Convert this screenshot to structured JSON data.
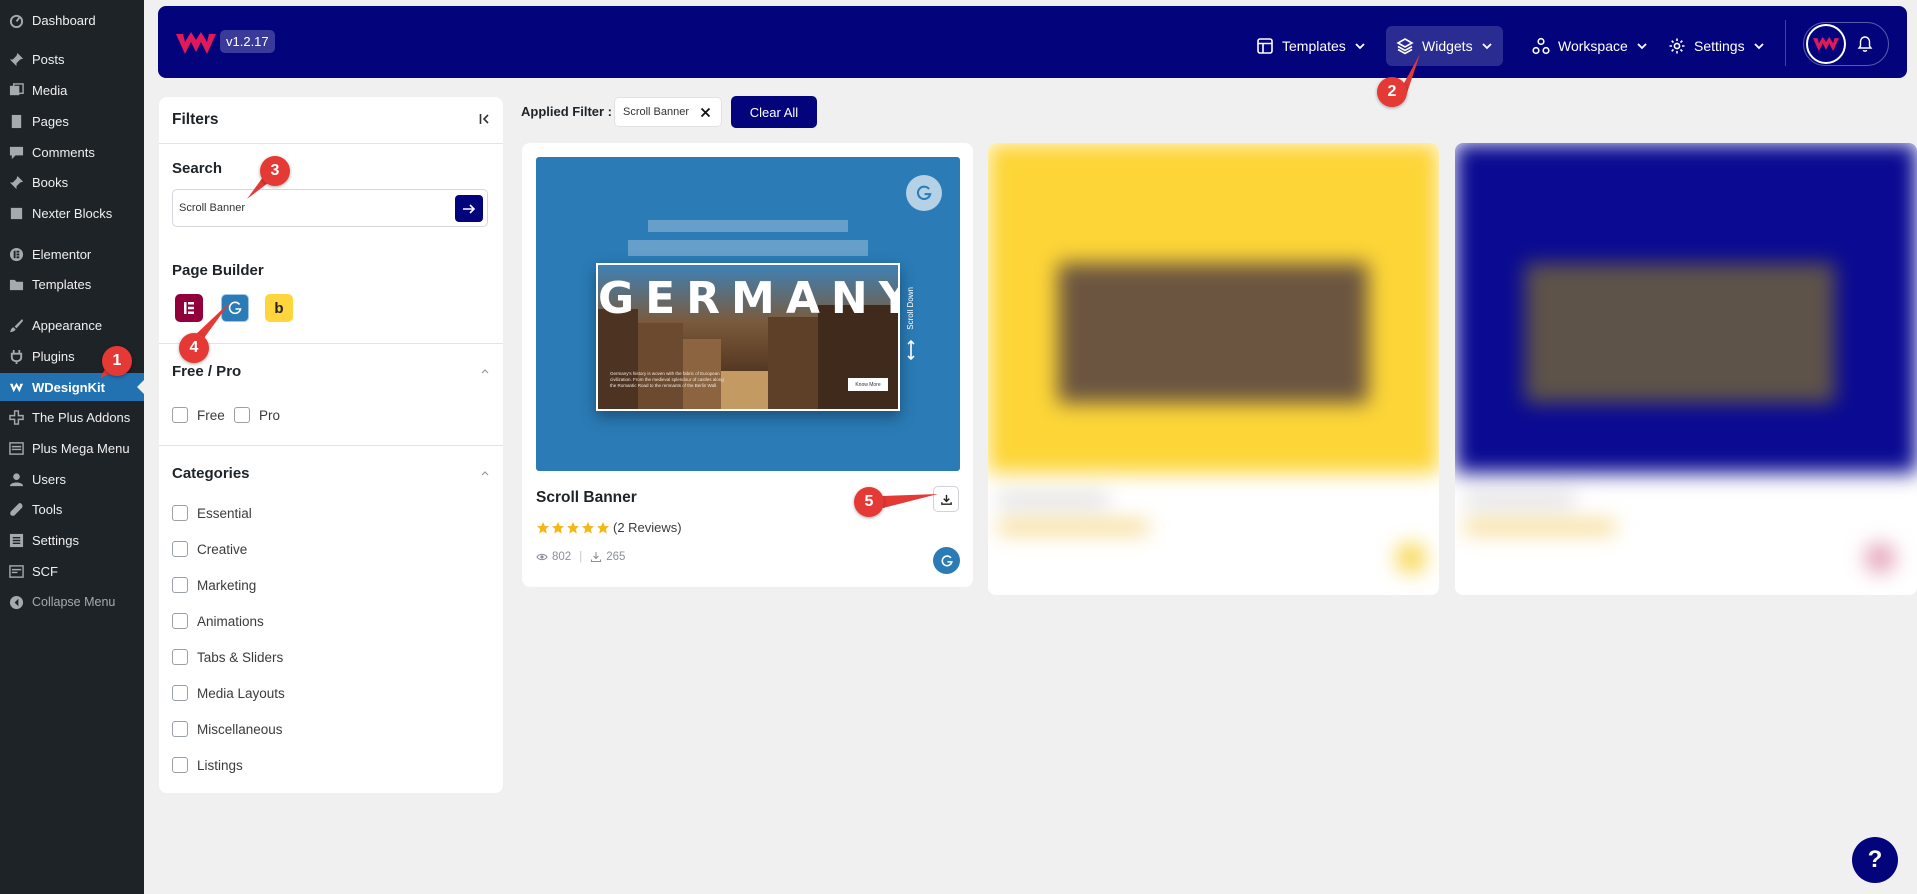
{
  "sidebar": {
    "items": [
      {
        "label": "Dashboard",
        "icon": "dashboard-icon"
      },
      {
        "label": "Posts",
        "icon": "pin-icon"
      },
      {
        "label": "Media",
        "icon": "media-icon"
      },
      {
        "label": "Pages",
        "icon": "pages-icon"
      },
      {
        "label": "Comments",
        "icon": "comments-icon"
      },
      {
        "label": "Books",
        "icon": "pin-icon"
      },
      {
        "label": "Nexter Blocks",
        "icon": "nexter-icon"
      },
      {
        "label": "Elementor",
        "icon": "elementor-icon"
      },
      {
        "label": "Templates",
        "icon": "folder-icon"
      },
      {
        "label": "Appearance",
        "icon": "brush-icon"
      },
      {
        "label": "Plugins",
        "icon": "plugin-icon"
      },
      {
        "label": "WDesignKit",
        "icon": "wdesignkit-icon"
      },
      {
        "label": "The Plus Addons",
        "icon": "plus-icon"
      },
      {
        "label": "Plus Mega Menu",
        "icon": "menu-icon"
      },
      {
        "label": "Users",
        "icon": "user-icon"
      },
      {
        "label": "Tools",
        "icon": "wrench-icon"
      },
      {
        "label": "Settings",
        "icon": "settings-icon"
      },
      {
        "label": "SCF",
        "icon": "scf-icon"
      },
      {
        "label": "Collapse Menu",
        "icon": "collapse-icon"
      }
    ]
  },
  "header": {
    "version": "v1.2.17",
    "nav": [
      {
        "label": "Templates",
        "icon": "templates-icon"
      },
      {
        "label": "Widgets",
        "icon": "layers-icon"
      },
      {
        "label": "Workspace",
        "icon": "workspace-icon"
      },
      {
        "label": "Settings",
        "icon": "gear-icon"
      }
    ]
  },
  "filters": {
    "title": "Filters",
    "search_heading": "Search",
    "search_value": "Scroll Banner",
    "page_builder_heading": "Page Builder",
    "builders": [
      "elementor",
      "gutenberg",
      "bricks"
    ],
    "bricks_letter": "b",
    "free_pro_heading": "Free / Pro",
    "free_pro": [
      "Free",
      "Pro"
    ],
    "categories_heading": "Categories",
    "categories": [
      "Essential",
      "Creative",
      "Marketing",
      "Animations",
      "Tabs & Sliders",
      "Media Layouts",
      "Miscellaneous",
      "Listings"
    ]
  },
  "applied": {
    "label": "Applied Filter :",
    "chip": "Scroll Banner",
    "clear_all": "Clear All"
  },
  "card": {
    "title": "Scroll Banner",
    "rating": 5,
    "reviews": "(2 Reviews)",
    "views": "802",
    "downloads": "265",
    "preview": {
      "headline": "GERMANY",
      "body_text": "Germany's history is woven with the fabric of European civilization. From the medieval splendour of castles along the Romantic Road to the remnants of the Berlin Wall.",
      "button": "Know More",
      "scroll_label": "Scroll Down"
    }
  },
  "markers": [
    "1",
    "2",
    "3",
    "4",
    "5"
  ],
  "help": "?",
  "colors": {
    "brand": "#03047c",
    "wp_sidebar": "#1d2327",
    "wp_active": "#2271b1",
    "marker": "#e53935",
    "card_preview": "#2a7bb6",
    "star": "#f5b716"
  }
}
